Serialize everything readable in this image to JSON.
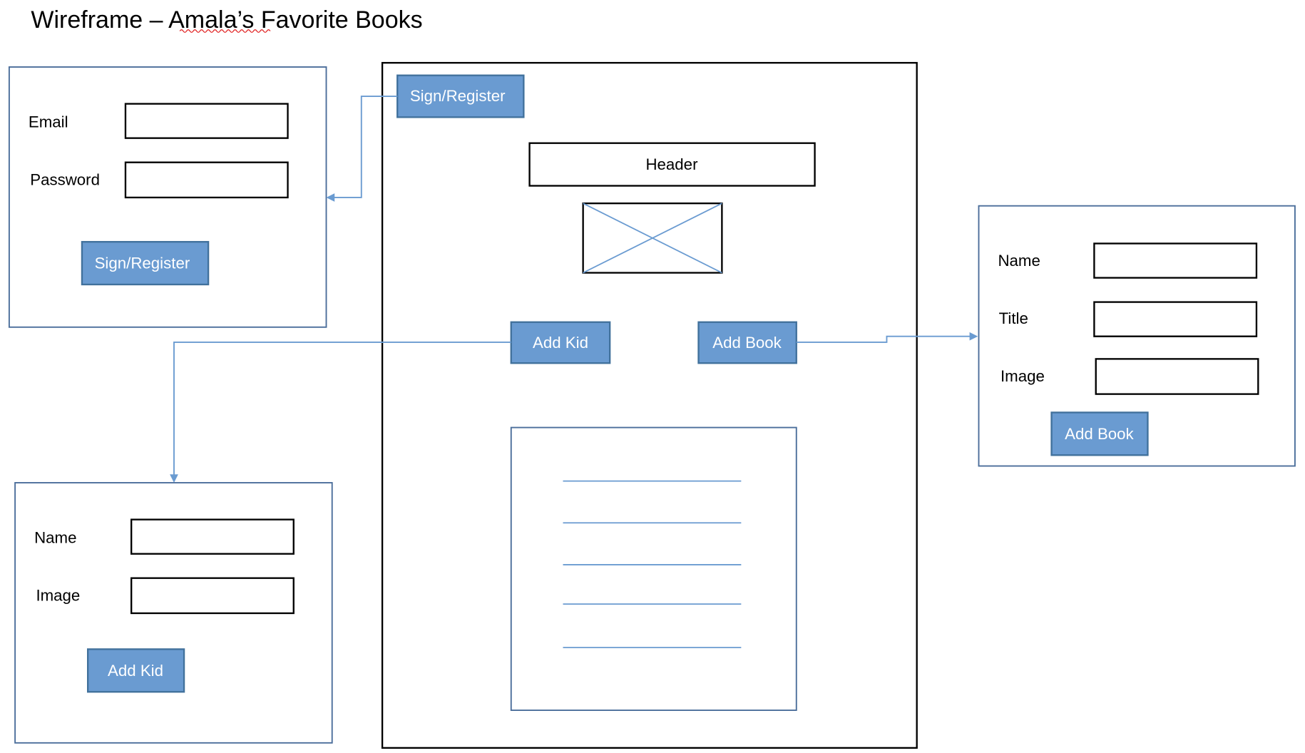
{
  "title": "Wireframe – Amala’s Favorite Books",
  "login_panel": {
    "email_label": "Email",
    "password_label": "Password",
    "button": "Sign/Register"
  },
  "main_page": {
    "sign_button": "Sign/Register",
    "header": "Header",
    "add_kid_button": "Add Kid",
    "add_book_button": "Add Book"
  },
  "book_panel": {
    "name_label": "Name",
    "title_label": "Title",
    "image_label": "Image",
    "button": "Add Book"
  },
  "kid_panel": {
    "name_label": "Name",
    "image_label": "Image",
    "button": "Add Kid"
  },
  "colors": {
    "button": "#6a9bd1",
    "panel_border": "#4a6d9a",
    "connector": "#6a9bd1"
  }
}
